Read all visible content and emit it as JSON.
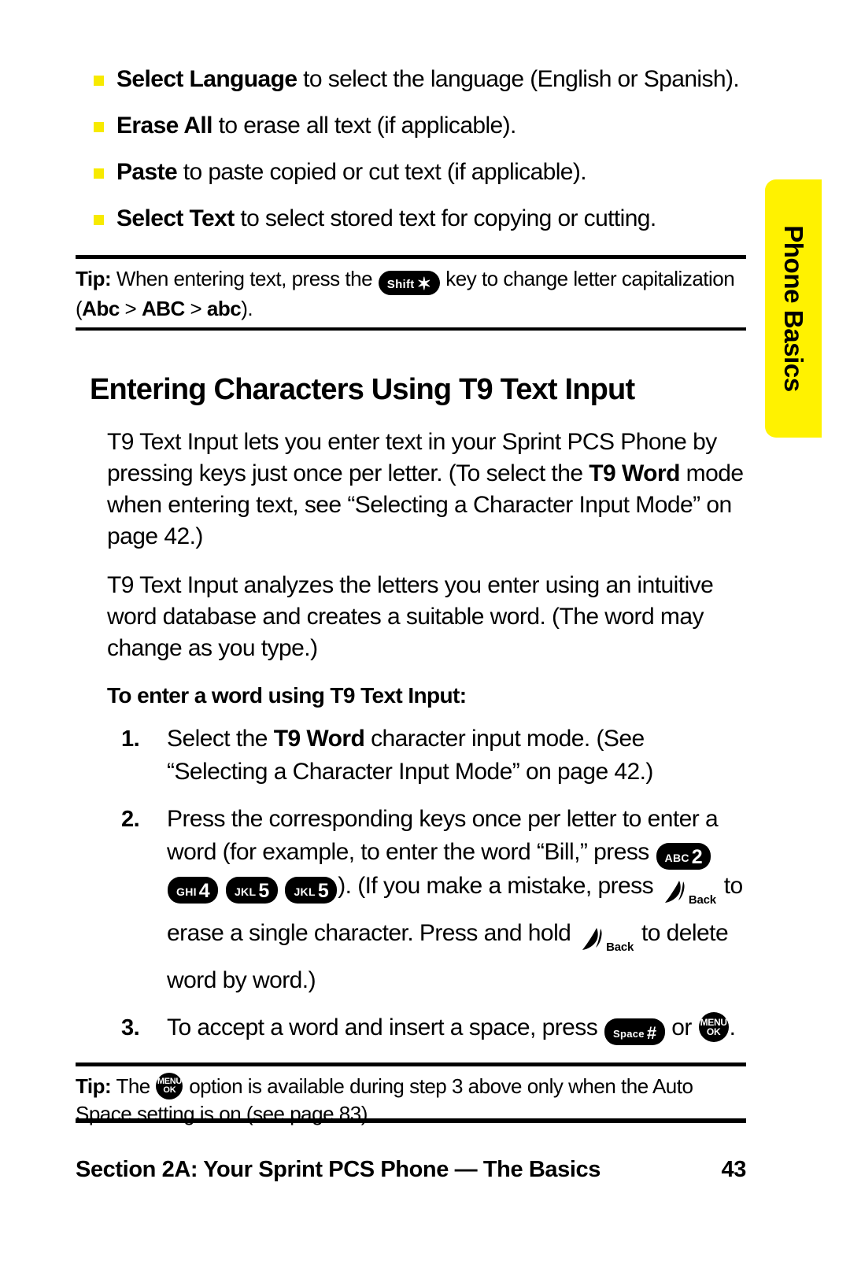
{
  "page": {
    "number": "43",
    "side_tab_label": "Phone Basics",
    "side_tab_color": "#fff200",
    "bullet_color": "#f7ea00",
    "footer_title": "Section 2A: Your Sprint PCS Phone — The Basics"
  },
  "bullets": [
    {
      "bold": "Select Language",
      "rest": " to select the language (English or Spanish)."
    },
    {
      "bold": "Erase All",
      "rest": " to erase all text (if applicable)."
    },
    {
      "bold": "Paste",
      "rest": " to paste copied or cut text (if applicable)."
    },
    {
      "bold": "Select Text",
      "rest": " to select stored text for copying or cutting."
    }
  ],
  "tip_top": {
    "label": "Tip:",
    "text_before_key": " When entering text, press the ",
    "key": {
      "sub": "Shift",
      "main": "✶"
    },
    "text_after_key": " key to change letter capitalization (",
    "seq_1": "Abc",
    "sep_1": " > ",
    "seq_2": "ABC",
    "sep_2": " > ",
    "seq_3": "abc",
    "text_end": ")."
  },
  "heading": "Entering Characters Using T9 Text Input",
  "paragraphs": [
    {
      "a": "T9 Text Input lets you enter text in your Sprint PCS Phone by pressing keys just once per letter. (To select the ",
      "bold": "T9 Word",
      "b": " mode when entering text, see “Selecting a Character Input Mode” on page 42.)"
    },
    {
      "a": "T9 Text Input analyzes the letters you enter using an intuitive word database and creates a suitable word. (The word may change as you type.)",
      "bold": "",
      "b": ""
    }
  ],
  "sub_heading": "To enter a word using T9 Text Input:",
  "steps": [
    {
      "num": "1.",
      "a": "Select the ",
      "bold": "T9 Word",
      "b": " character input mode. (See “Selecting a Character Input Mode” on page 42.)"
    },
    {
      "num": "2.",
      "a": "Press the corresponding keys once per letter to enter a word (for example, to enter the word “Bill,” press ",
      "keys": [
        {
          "sub": "ABC",
          "main": "2"
        },
        {
          "sub": "GHI",
          "main": "4"
        },
        {
          "sub": "JKL",
          "main": "5"
        },
        {
          "sub": "JKL",
          "main": "5"
        }
      ],
      "mid_1": "). (If you make a mistake, press ",
      "back_label": "Back",
      "mid_2": " to erase a single character. Press and hold ",
      "mid_3": " to delete word by word.)"
    },
    {
      "num": "3.",
      "a": "To accept a word and insert a space, press ",
      "space_key": {
        "sub": "Space",
        "main": "#"
      },
      "mid": " or ",
      "menu_key": {
        "line1": "MENU",
        "line2": "OK"
      },
      "end": "."
    }
  ],
  "tip_bottom": {
    "label": "Tip:",
    "text_before_key": " The ",
    "menu_key": {
      "line1": "MENU",
      "line2": "OK"
    },
    "text_after_key": " option is available during step 3 above only when the Auto Space setting is on (see page 83)."
  }
}
